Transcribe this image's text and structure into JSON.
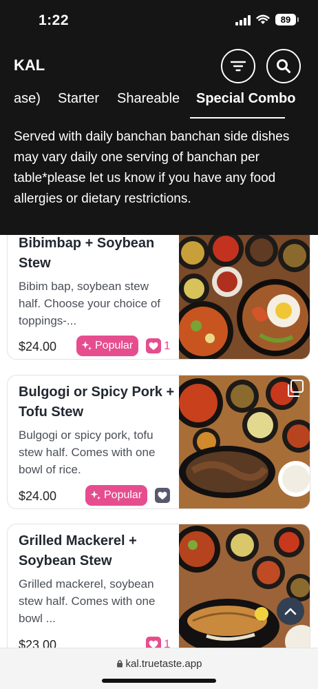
{
  "status_bar": {
    "time": "1:22",
    "battery": "89"
  },
  "header": {
    "restaurant_name": "KAL",
    "filter_icon": "filter-lines-icon",
    "search_icon": "search-icon"
  },
  "tabs": [
    {
      "label": "ase)"
    },
    {
      "label": "Starter"
    },
    {
      "label": "Shareable"
    },
    {
      "label": "Special Combo",
      "active": true
    }
  ],
  "category_description": "Served with daily banchan banchan side dishes may vary daily one serving of banchan per table*please let us know if you have any food allergies or dietary restrictions.",
  "menu_items": [
    {
      "title": "Bibimbap + Soybean Stew",
      "description": "Bibim bap, soybean stew half. Choose your choice of toppings-...",
      "price": "$24.00",
      "popular_label": "Popular",
      "likes": "1"
    },
    {
      "title": "Bulgogi or Spicy Pork + Tofu Stew",
      "description": "Bulgogi or spicy pork, tofu stew half. Comes with one bowl of rice.",
      "price": "$24.00",
      "popular_label": "Popular",
      "likes": ""
    },
    {
      "title": "Grilled Mackerel + Soybean Stew",
      "description": "Grilled mackerel, soybean stew half. Comes with one bowl ...",
      "price": "$23.00",
      "popular_label": "",
      "likes": "1"
    }
  ],
  "browser": {
    "url": "kal.truetaste.app"
  },
  "colors": {
    "header_bg": "#151515",
    "accent_pink": "#e64d8e",
    "scroll_button": "#333f52",
    "title_text": "#222831"
  }
}
